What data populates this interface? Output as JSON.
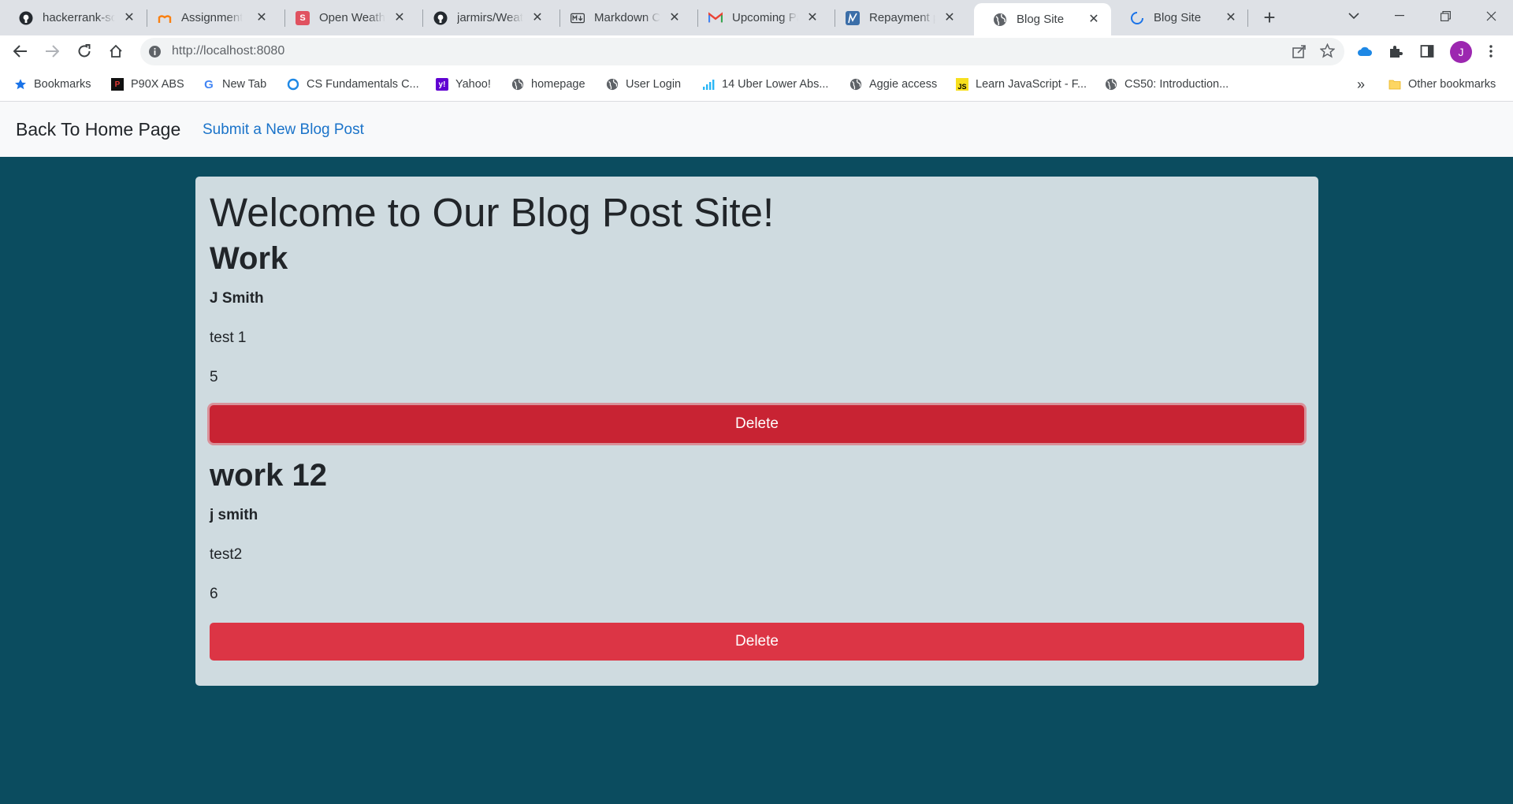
{
  "browser": {
    "tabs": [
      {
        "title": "hackerrank-sol",
        "icon": "github-icon"
      },
      {
        "title": "Assignment",
        "icon": "moodle-icon"
      },
      {
        "title": "Open Weather",
        "icon": "s-app-icon"
      },
      {
        "title": "jarmirs/Weathe",
        "icon": "github-icon"
      },
      {
        "title": "Markdown Che",
        "icon": "markdown-icon"
      },
      {
        "title": "Upcoming Pay",
        "icon": "gmail-icon"
      },
      {
        "title": "Repayment pr",
        "icon": "chart-icon"
      },
      {
        "title": "Blog Site",
        "icon": "globe-icon",
        "active": true
      },
      {
        "title": "Blog Site",
        "icon": "loading-icon"
      }
    ],
    "url": "http://localhost:8080",
    "profile_initial": "J",
    "bookmarks": [
      {
        "label": "Bookmarks",
        "icon": "star-icon"
      },
      {
        "label": "P90X ABS",
        "icon": "p90x-icon"
      },
      {
        "label": "New Tab",
        "icon": "google-icon"
      },
      {
        "label": "CS Fundamentals C...",
        "icon": "circle-icon"
      },
      {
        "label": "Yahoo!",
        "icon": "yahoo-icon"
      },
      {
        "label": "homepage",
        "icon": "globe-icon"
      },
      {
        "label": "User Login",
        "icon": "globe-icon"
      },
      {
        "label": "14 Uber Lower Abs...",
        "icon": "bars-icon"
      },
      {
        "label": "Aggie access",
        "icon": "globe-icon"
      },
      {
        "label": "Learn JavaScript - F...",
        "icon": "js-icon"
      },
      {
        "label": "CS50: Introduction...",
        "icon": "globe-icon"
      }
    ],
    "overflow": "»",
    "other_bookmarks": "Other bookmarks"
  },
  "navbar": {
    "brand": "Back To Home Page",
    "link": "Submit a New Blog Post"
  },
  "main": {
    "title": "Welcome to Our Blog Post Site!",
    "posts": [
      {
        "title": "Work",
        "author": "J Smith",
        "content": "test 1",
        "value": "5",
        "delete_label": "Delete"
      },
      {
        "title": "work 12",
        "author": "j smith",
        "content": "test2",
        "value": "6",
        "delete_label": "Delete"
      }
    ]
  },
  "colors": {
    "page_background": "#0b4c5f",
    "card_background": "#cfdbe0",
    "danger": "#dc3545",
    "link": "#1a73c9"
  }
}
